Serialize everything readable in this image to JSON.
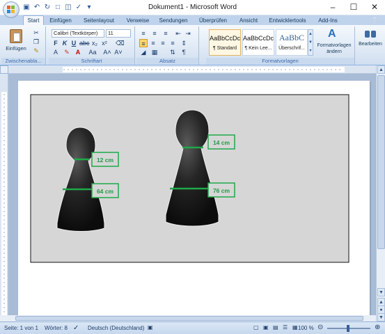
{
  "window": {
    "title": "Dokument1 - Microsoft Word",
    "qat_icons": [
      "save-icon",
      "undo-icon",
      "redo-icon",
      "new-doc-icon",
      "open-icon",
      "spelling-icon",
      "customize-qat-icon"
    ]
  },
  "ribbon": {
    "tabs": [
      "Start",
      "Einfügen",
      "Seitenlayout",
      "Verweise",
      "Sendungen",
      "Überprüfen",
      "Ansicht",
      "Entwicklertools",
      "Add-Ins"
    ],
    "active_tab": "Start",
    "clipboard": {
      "paste_label": "Einfügen",
      "group_label": "Zwischenabla..."
    },
    "font": {
      "name": "Calibri (Textkörper)",
      "size": "11",
      "group_label": "Schriftart"
    },
    "paragraph": {
      "group_label": "Absatz"
    },
    "styles": {
      "group_label": "Formatvorlagen",
      "items": [
        {
          "preview": "AaBbCcDc",
          "name": "¶ Standard"
        },
        {
          "preview": "AaBbCcDc",
          "name": "¶ Kein Lee..."
        },
        {
          "preview": "AaBbC",
          "name": "Überschrif..."
        }
      ],
      "change_label_1": "Formatvorlagen",
      "change_label_2": "ändern"
    },
    "editing": {
      "label": "Bearbeiten"
    }
  },
  "document": {
    "labels": {
      "small_neck": "12 cm",
      "small_base": "64 cm",
      "large_neck": "14 cm",
      "large_base": "76 cm"
    }
  },
  "statusbar": {
    "page": "Seite: 1 von 1",
    "words": "Wörter: 8",
    "language": "Deutsch (Deutschland)",
    "zoom": "100 %"
  }
}
